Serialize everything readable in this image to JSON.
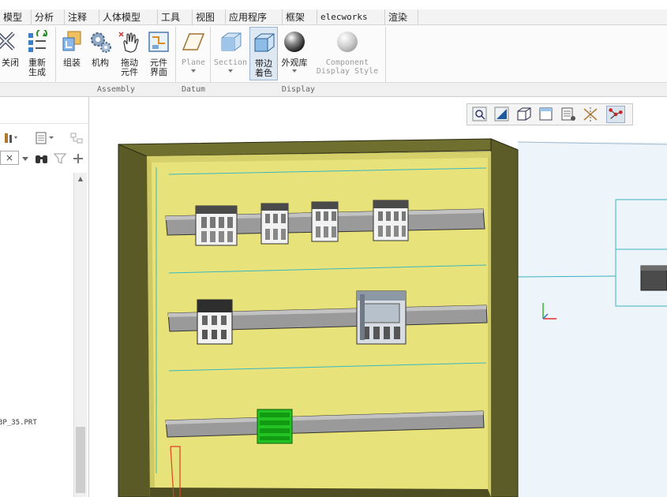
{
  "tabs": [
    {
      "label": "模型"
    },
    {
      "label": "分析"
    },
    {
      "label": "注释"
    },
    {
      "label": "人体模型"
    },
    {
      "label": "工具"
    },
    {
      "label": "视图"
    },
    {
      "label": "应用程序"
    },
    {
      "label": "框架"
    },
    {
      "label": "elecworks"
    },
    {
      "label": "渲染"
    }
  ],
  "ribbon": {
    "buttons": [
      {
        "label": "关闭",
        "icon": "close-icon"
      },
      {
        "label": "重新\n生成",
        "icon": "regenerate-icon"
      },
      {
        "label": "组装",
        "icon": "assemble-icon"
      },
      {
        "label": "机构",
        "icon": "mechanism-gear-icon"
      },
      {
        "label": "拖动\n元件",
        "icon": "drag-hand-icon"
      },
      {
        "label": "元件\n界面",
        "icon": "component-interface-icon"
      },
      {
        "label": "Plane",
        "icon": "plane-icon"
      },
      {
        "label": "Section",
        "icon": "section-icon"
      },
      {
        "label": "带边\n着色",
        "icon": "shaded-with-edges-icon"
      },
      {
        "label": "外观库",
        "icon": "appearance-sphere-icon"
      },
      {
        "label": "Component\nDisplay Style",
        "icon": "display-style-sphere-icon"
      }
    ],
    "groups": [
      {
        "label": "Assembly"
      },
      {
        "label": "Datum"
      },
      {
        "label": "Display"
      }
    ]
  },
  "left_panel": {
    "tree_item": "3P_35.PRT",
    "filter_value": "×"
  },
  "graphics_toolbar": [
    {
      "icon": "zoom-icon"
    },
    {
      "icon": "refit-icon"
    },
    {
      "icon": "display-style-icon"
    },
    {
      "icon": "saved-views-icon"
    },
    {
      "icon": "view-manager-icon"
    },
    {
      "icon": "datum-display-icon"
    },
    {
      "icon": "spin-center-icon"
    }
  ],
  "colors": {
    "cabinet_back": "#e8e27a",
    "cabinet_side": "#5c5c28",
    "din_rail": "#9a9a9a",
    "terminal_block": "#22c322",
    "wire": "#38b8c0",
    "door_panel": "#edf4fa"
  }
}
